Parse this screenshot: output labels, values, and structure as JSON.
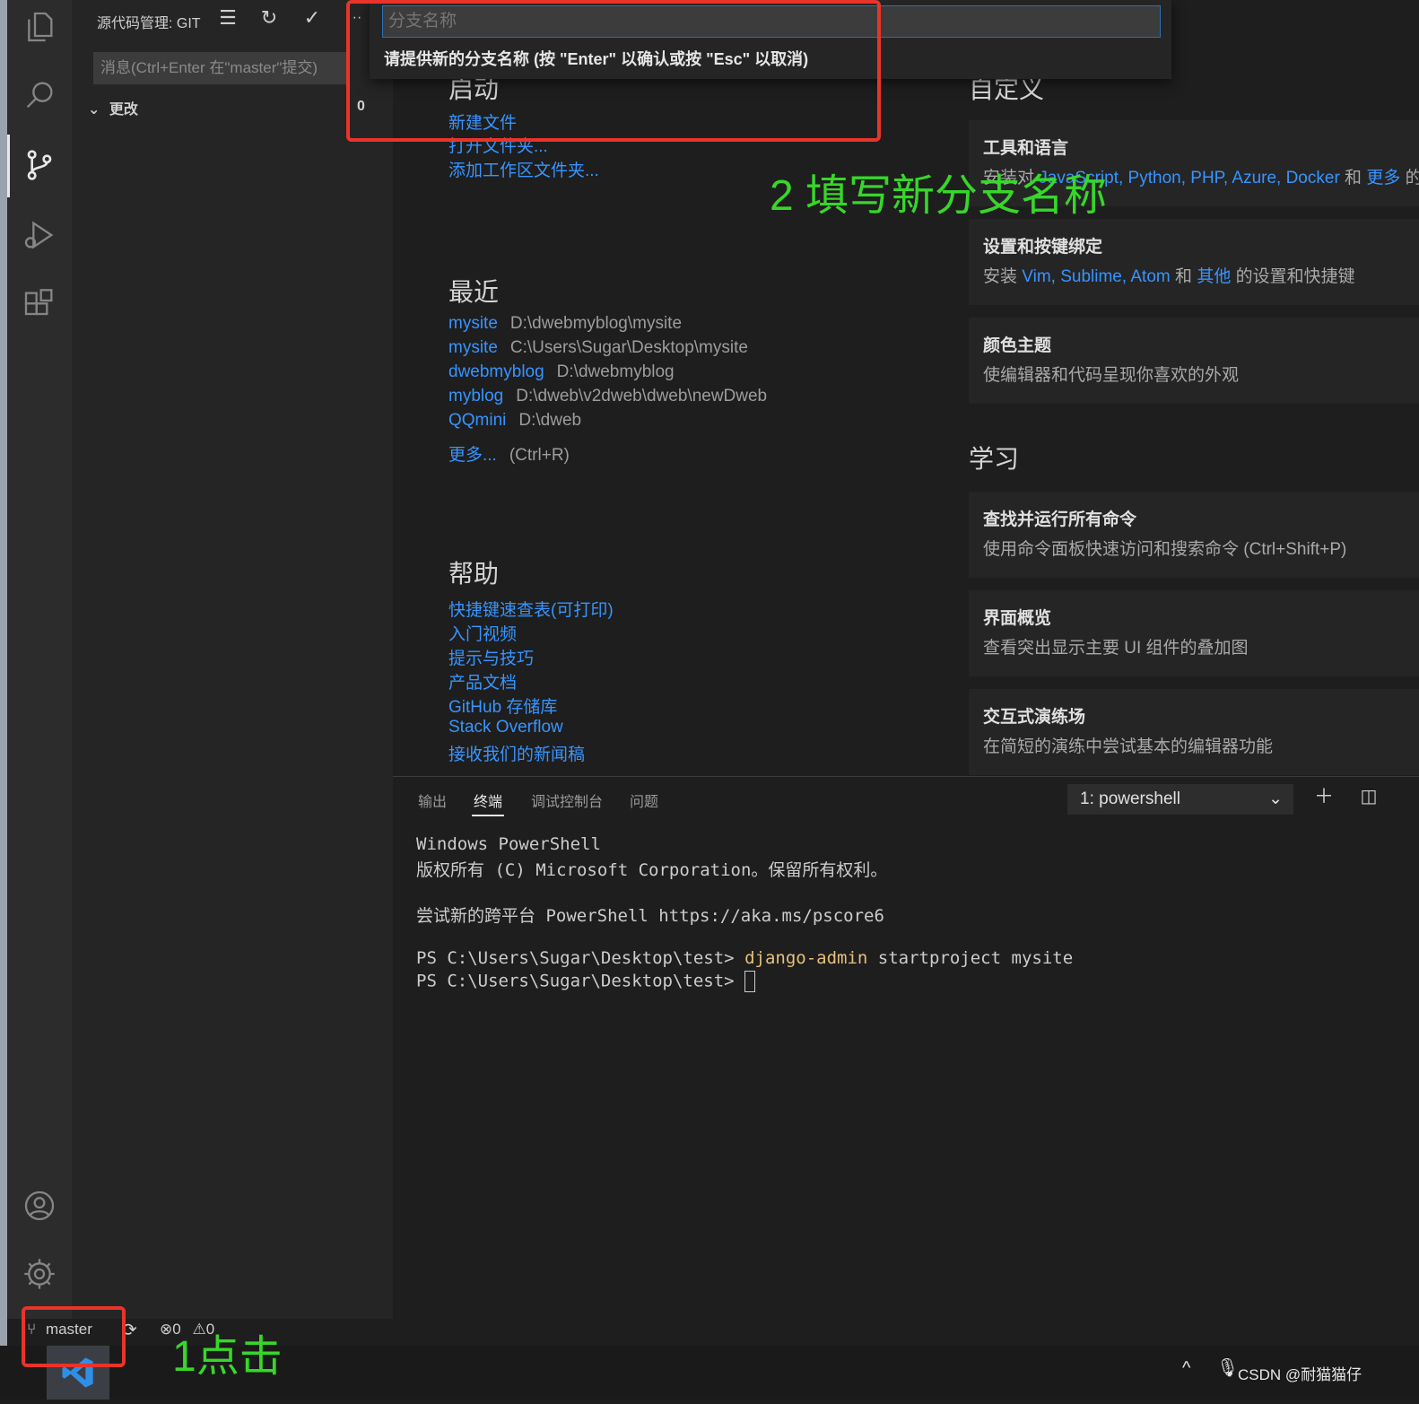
{
  "sidebar": {
    "title": "源代码管理: GIT",
    "commit_placeholder": "消息(Ctrl+Enter 在\"master\"提交)",
    "changes_label": "更改",
    "changes_count": "0"
  },
  "quick_input": {
    "placeholder": "分支名称",
    "hint": "请提供新的分支名称 (按 \"Enter\" 以确认或按 \"Esc\" 以取消)"
  },
  "welcome": {
    "start": {
      "heading": "启动",
      "links": [
        "新建文件",
        "打开文件夹...",
        "添加工作区文件夹..."
      ]
    },
    "recent": {
      "heading": "最近",
      "items": [
        {
          "name": "mysite",
          "path": "D:\\dwebmyblog\\mysite"
        },
        {
          "name": "mysite",
          "path": "C:\\Users\\Sugar\\Desktop\\mysite"
        },
        {
          "name": "dwebmyblog",
          "path": "D:\\dwebmyblog"
        },
        {
          "name": "myblog",
          "path": "D:\\dweb\\v2dweb\\dweb\\newDweb"
        },
        {
          "name": "QQmini",
          "path": "D:\\dweb"
        }
      ],
      "more": "更多...",
      "more_shortcut": "(Ctrl+R)"
    },
    "help": {
      "heading": "帮助",
      "links": [
        "快捷键速查表(可打印)",
        "入门视频",
        "提示与技巧",
        "产品文档",
        "GitHub 存储库",
        "Stack Overflow",
        "接收我们的新闻稿"
      ]
    },
    "customize": {
      "heading": "自定义",
      "cards": [
        {
          "title": "工具和语言",
          "desc_prefix": "安装对",
          "desc_links": "JavaScript, Python, PHP, Azure, Docker",
          "desc_mid": "和",
          "desc_more": "更多",
          "desc_suffix": "的"
        },
        {
          "title": "设置和按键绑定",
          "desc_prefix": "安装",
          "desc_links": "Vim, Sublime, Atom",
          "desc_mid": "和",
          "desc_more": "其他",
          "desc_suffix": "的设置和快捷键"
        },
        {
          "title": "颜色主题",
          "desc": "使编辑器和代码呈现你喜欢的外观"
        }
      ]
    },
    "learn": {
      "heading": "学习",
      "cards": [
        {
          "title": "查找并运行所有命令",
          "desc": "使用命令面板快速访问和搜索命令 (Ctrl+Shift+P)"
        },
        {
          "title": "界面概览",
          "desc": "查看突出显示主要 UI 组件的叠加图"
        },
        {
          "title": "交互式演练场",
          "desc": "在简短的演练中尝试基本的编辑器功能"
        }
      ]
    }
  },
  "panel": {
    "tabs": [
      "输出",
      "终端",
      "调试控制台",
      "问题"
    ],
    "terminal_select": "1: powershell",
    "lines": [
      "Windows PowerShell",
      "版权所有 (C) Microsoft Corporation。保留所有权利。",
      "尝试新的跨平台 PowerShell https://aka.ms/pscore6"
    ],
    "prompt": "PS C:\\Users\\Sugar\\Desktop\\test>",
    "cmd_name": "django-admin",
    "cmd_args": "startproject mysite"
  },
  "statusbar": {
    "branch": "master",
    "errors": "0",
    "warnings": "0"
  },
  "annotations": {
    "step1": "1点击",
    "step2": "2 填写新分支名称"
  },
  "taskbar": {
    "tray_text": "CSDN @耐猫猫仔"
  },
  "colors": {
    "annotation_box": "#e8342a",
    "annotation_text": "#37d72a",
    "link": "#3794ff"
  }
}
